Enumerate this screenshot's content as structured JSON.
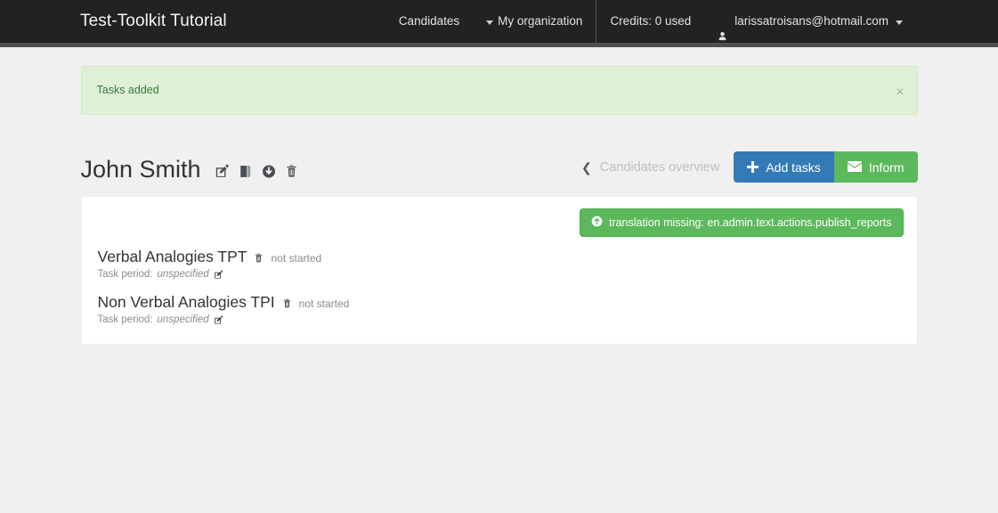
{
  "navbar": {
    "brand": "Test-Toolkit Tutorial",
    "items": [
      {
        "label": "Candidates",
        "name": "nav-candidates",
        "icon": null
      },
      {
        "label": "My organization",
        "name": "nav-my-organization",
        "icon": "caret-left-icon"
      }
    ],
    "credits": "Credits: 0 used",
    "user": {
      "email": "larissatroisans@hotmail.com",
      "icon": "user-icon",
      "caret": "caret-down-icon"
    }
  },
  "alert": {
    "message": "Tasks added",
    "close_label": "×",
    "bg_color": "#dff0d8",
    "text_color": "#3c763d"
  },
  "page": {
    "title": "John Smith",
    "title_icons": [
      {
        "name": "edit-icon",
        "title": "Edit"
      },
      {
        "name": "book-icon",
        "title": "Reports"
      },
      {
        "name": "download-icon",
        "title": "Download"
      },
      {
        "name": "trash-icon",
        "title": "Delete"
      }
    ],
    "back_link": "Candidates overview",
    "buttons": [
      {
        "label": "Add tasks",
        "icon": "plus-icon",
        "name": "add-tasks-button",
        "color": "#337ab7"
      },
      {
        "label": "Inform",
        "icon": "envelope-icon",
        "name": "inform-button",
        "color": "#5cb85c"
      }
    ]
  },
  "panel": {
    "publish_button": {
      "label": "translation missing: en.admin.text.actions.publish_reports",
      "icon": "circle-arrow-up-icon",
      "color": "#5cb85c"
    },
    "tasks": [
      {
        "name": "Verbal Analogies TPT",
        "status": "not started",
        "meta_label": "Task period:",
        "meta_value": "unspecified",
        "trash_icon": "trash-icon",
        "edit_icon": "edit-icon"
      },
      {
        "name": "Non Verbal Analogies TPI",
        "status": "not started",
        "meta_label": "Task period:",
        "meta_value": "unspecified",
        "trash_icon": "trash-icon",
        "edit_icon": "edit-icon"
      }
    ]
  }
}
